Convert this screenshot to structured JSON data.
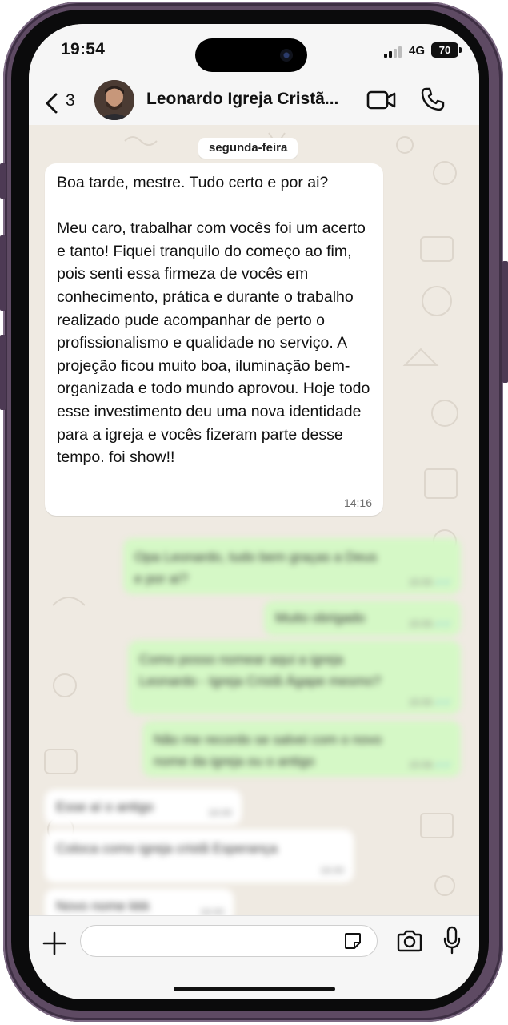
{
  "status_bar": {
    "time": "19:54",
    "network": "4G",
    "battery": "70"
  },
  "header": {
    "back_count": "3",
    "contact_name": "Leonardo Igreja Cristã..."
  },
  "chat": {
    "date_label": "segunda-feira",
    "incoming_message": {
      "text": "Boa tarde, mestre. Tudo certo e por ai?\n\nMeu caro, trabalhar com vocês foi um acerto e tanto! Fiquei tranquilo do começo ao fim, pois senti essa firmeza de vocês em conhecimento, prática e durante o trabalho realizado pude acompanhar de perto o profissionalismo e qualidade no serviço. A projeção ficou muito boa, iluminação bem-organizada e todo mundo aprovou. Hoje todo esse investimento deu uma nova identidade para a igreja e vocês fizeram parte desse tempo. foi show!!",
      "time": "14:16"
    },
    "blurred_messages": [
      {
        "text": "Opa Leonardo, tudo bem graças a Deus\ne por aí?",
        "time": "15:55"
      },
      {
        "text": "Muito obrigado",
        "time": "15:55"
      },
      {
        "text": "Como posso nomear aqui a igreja\nLeonardo - Igreja Cristã Ágape mesmo?",
        "time": "15:55"
      },
      {
        "text": "Não me recordo se salvei com o novo\nnome da igreja ou o antigo",
        "time": "15:56"
      },
      {
        "text": "Esse aí o antigo",
        "time": "16:00"
      },
      {
        "text": "Coloca como igreja cristã Esperança",
        "time": "16:00"
      },
      {
        "text": "Novo nome kkk",
        "time": "16:00"
      }
    ]
  },
  "composer": {
    "input_value": ""
  },
  "colors": {
    "outgoing_bubble": "#d5f8c6",
    "chat_bg": "#efeae2",
    "read_tick": "#4fb6ec"
  }
}
